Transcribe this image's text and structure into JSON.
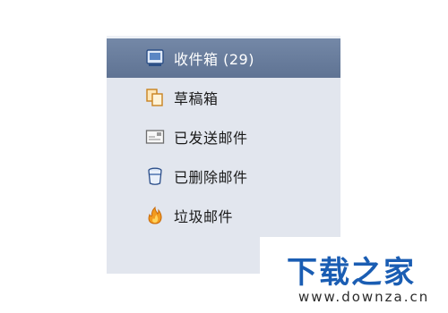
{
  "folders": [
    {
      "label": "收件箱 (29)",
      "icon": "inbox-icon",
      "selected": true
    },
    {
      "label": "草稿箱",
      "icon": "drafts-icon",
      "selected": false
    },
    {
      "label": "已发送邮件",
      "icon": "sent-mail-icon",
      "selected": false
    },
    {
      "label": "已删除邮件",
      "icon": "trash-icon",
      "selected": false
    },
    {
      "label": "垃圾邮件",
      "icon": "junk-mail-icon",
      "selected": false
    }
  ],
  "watermark": {
    "logo": "下载之家",
    "url": "www.downza.cn"
  },
  "colors": {
    "panel_bg": "#e2e6ee",
    "selected_bg": "#6a7e9e",
    "logo_blue": "#1a5db3"
  }
}
